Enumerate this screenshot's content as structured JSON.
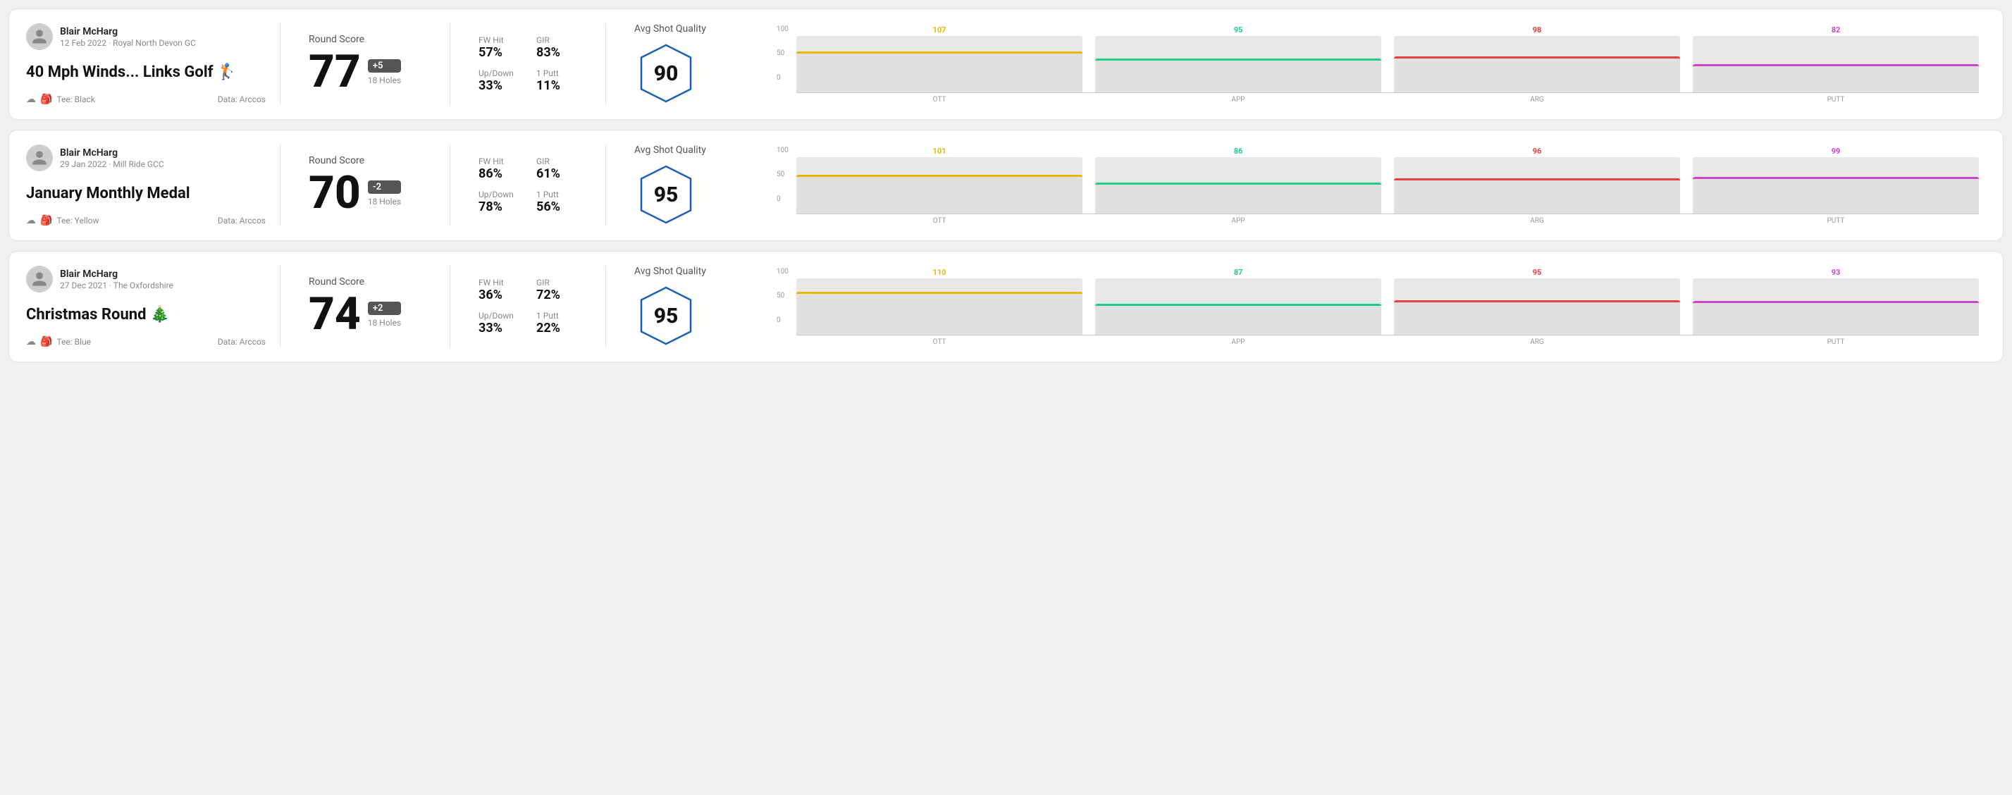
{
  "cards": [
    {
      "id": "card1",
      "user": {
        "name": "Blair McHarg",
        "date": "12 Feb 2022 · Royal North Devon GC"
      },
      "title": "40 Mph Winds... Links Golf 🏌",
      "tee": "Black",
      "data_source": "Data: Arccos",
      "score": {
        "label": "Round Score",
        "number": "77",
        "badge": "+5",
        "holes": "18 Holes"
      },
      "stats": {
        "fw_hit_label": "FW Hit",
        "fw_hit_value": "57%",
        "gir_label": "GIR",
        "gir_value": "83%",
        "updown_label": "Up/Down",
        "updown_value": "33%",
        "oneputt_label": "1 Putt",
        "oneputt_value": "11%"
      },
      "quality": {
        "label": "Avg Shot Quality",
        "score": "90"
      },
      "chart": {
        "bars": [
          {
            "label": "OTT",
            "top_value": "107",
            "color": "#e8b800",
            "height_pct": 72
          },
          {
            "label": "APP",
            "top_value": "95",
            "color": "#22cc88",
            "height_pct": 60
          },
          {
            "label": "ARG",
            "top_value": "98",
            "color": "#e84040",
            "height_pct": 63
          },
          {
            "label": "PUTT",
            "top_value": "82",
            "color": "#cc44cc",
            "height_pct": 50
          }
        ],
        "y_labels": [
          "100",
          "50",
          "0"
        ]
      }
    },
    {
      "id": "card2",
      "user": {
        "name": "Blair McHarg",
        "date": "29 Jan 2022 · Mill Ride GCC"
      },
      "title": "January Monthly Medal",
      "tee": "Yellow",
      "data_source": "Data: Arccos",
      "score": {
        "label": "Round Score",
        "number": "70",
        "badge": "-2",
        "holes": "18 Holes"
      },
      "stats": {
        "fw_hit_label": "FW Hit",
        "fw_hit_value": "86%",
        "gir_label": "GIR",
        "gir_value": "61%",
        "updown_label": "Up/Down",
        "updown_value": "78%",
        "oneputt_label": "1 Putt",
        "oneputt_value": "56%"
      },
      "quality": {
        "label": "Avg Shot Quality",
        "score": "95"
      },
      "chart": {
        "bars": [
          {
            "label": "OTT",
            "top_value": "101",
            "color": "#e8b800",
            "height_pct": 68
          },
          {
            "label": "APP",
            "top_value": "86",
            "color": "#22cc88",
            "height_pct": 54
          },
          {
            "label": "ARG",
            "top_value": "96",
            "color": "#e84040",
            "height_pct": 62
          },
          {
            "label": "PUTT",
            "top_value": "99",
            "color": "#cc44cc",
            "height_pct": 65
          }
        ],
        "y_labels": [
          "100",
          "50",
          "0"
        ]
      }
    },
    {
      "id": "card3",
      "user": {
        "name": "Blair McHarg",
        "date": "27 Dec 2021 · The Oxfordshire"
      },
      "title": "Christmas Round 🎄",
      "tee": "Blue",
      "data_source": "Data: Arccos",
      "score": {
        "label": "Round Score",
        "number": "74",
        "badge": "+2",
        "holes": "18 Holes"
      },
      "stats": {
        "fw_hit_label": "FW Hit",
        "fw_hit_value": "36%",
        "gir_label": "GIR",
        "gir_value": "72%",
        "updown_label": "Up/Down",
        "updown_value": "33%",
        "oneputt_label": "1 Putt",
        "oneputt_value": "22%"
      },
      "quality": {
        "label": "Avg Shot Quality",
        "score": "95"
      },
      "chart": {
        "bars": [
          {
            "label": "OTT",
            "top_value": "110",
            "color": "#e8b800",
            "height_pct": 76
          },
          {
            "label": "APP",
            "top_value": "87",
            "color": "#22cc88",
            "height_pct": 55
          },
          {
            "label": "ARG",
            "top_value": "95",
            "color": "#e84040",
            "height_pct": 61
          },
          {
            "label": "PUTT",
            "top_value": "93",
            "color": "#cc44cc",
            "height_pct": 60
          }
        ],
        "y_labels": [
          "100",
          "50",
          "0"
        ]
      }
    }
  ]
}
